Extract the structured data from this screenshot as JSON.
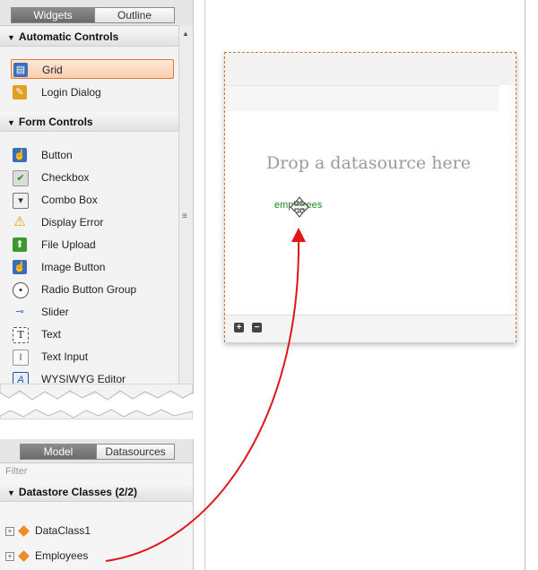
{
  "widgets_panel": {
    "tabs": [
      {
        "label": "Widgets",
        "active": true
      },
      {
        "label": "Outline",
        "active": false
      }
    ],
    "sections": {
      "automatic": {
        "title": "Automatic Controls",
        "items": [
          {
            "label": "Grid",
            "icon": "grid-icon",
            "selected": true
          },
          {
            "label": "Login Dialog",
            "icon": "login-dialog-icon"
          }
        ]
      },
      "form": {
        "title": "Form Controls",
        "items": [
          {
            "label": "Button",
            "icon": "button-icon"
          },
          {
            "label": "Checkbox",
            "icon": "checkbox-icon"
          },
          {
            "label": "Combo Box",
            "icon": "combo-box-icon"
          },
          {
            "label": "Display Error",
            "icon": "warning-icon"
          },
          {
            "label": "File Upload",
            "icon": "file-upload-icon"
          },
          {
            "label": "Image Button",
            "icon": "image-button-icon"
          },
          {
            "label": "Radio Button Group",
            "icon": "radio-icon"
          },
          {
            "label": "Slider",
            "icon": "slider-icon"
          },
          {
            "label": "Text",
            "icon": "text-icon"
          },
          {
            "label": "Text Input",
            "icon": "text-input-icon"
          },
          {
            "label": "WYSIWYG Editor",
            "icon": "wysiwyg-icon"
          }
        ]
      }
    }
  },
  "model_panel": {
    "tabs": [
      {
        "label": "Model",
        "active": true
      },
      {
        "label": "Datasources",
        "active": false
      }
    ],
    "filter_placeholder": "Filter",
    "section_title": "Datastore Classes (2/2)",
    "classes": [
      {
        "label": "DataClass1"
      },
      {
        "label": "Employees"
      }
    ]
  },
  "canvas": {
    "drop_text": "Drop a datasource here",
    "drag_label": "employees"
  },
  "colors": {
    "accent": "#e3782e",
    "drag_arrow": "#e0161b",
    "drag_text": "#1e8a1e"
  }
}
